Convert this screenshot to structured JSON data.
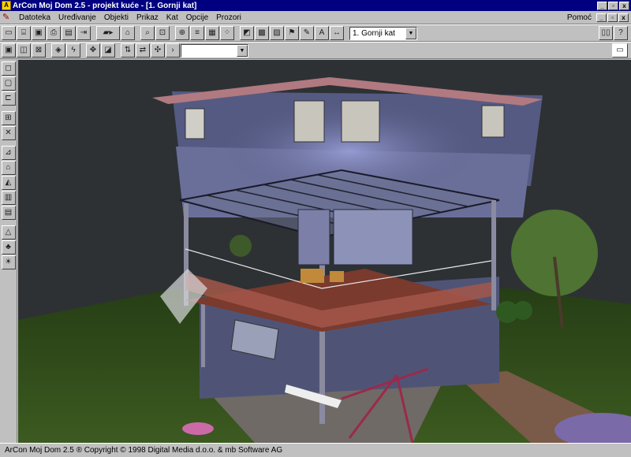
{
  "window": {
    "title": "ArCon Moj Dom  2.5 - projekt kuće - [1. Gornji kat]",
    "buttons": [
      "_",
      "▫",
      "x"
    ]
  },
  "menu": {
    "items": [
      "Datoteka",
      "Uređivanje",
      "Objekti",
      "Prikaz",
      "Kat",
      "Opcije",
      "Prozori"
    ],
    "help": "Pomoć",
    "mdi_buttons": [
      "_",
      "▫",
      "x"
    ]
  },
  "toolbar": {
    "floor_select": "1. Gornji kat",
    "view_select": ""
  },
  "status": {
    "text": "ArCon Moj Dom 2.5 ® Copyright © 1998 Digital Media d.o.o. & mb Software AG"
  },
  "colors": {
    "title_bar": "#000080",
    "chrome": "#c0c0c0",
    "viewport_bg": "#2d3134",
    "lawn": "#2e4a1a",
    "wall": "#5a5f86",
    "railing": "#9a4a3c"
  },
  "icons": {
    "app": "arcon-app-icon",
    "document": "document-icon"
  }
}
